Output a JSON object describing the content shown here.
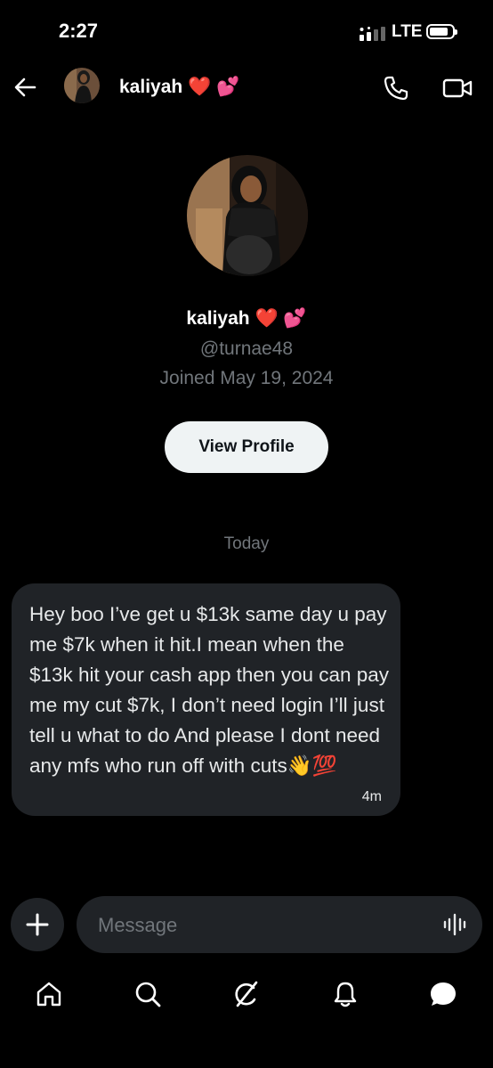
{
  "status_bar": {
    "time": "2:27",
    "network": "LTE"
  },
  "header": {
    "contact_name": "kaliyah",
    "name_emojis": "❤️ 💕"
  },
  "profile": {
    "name": "kaliyah",
    "name_emojis": "❤️ 💕",
    "handle": "@turnae48",
    "joined": "Joined May 19, 2024",
    "view_profile_label": "View Profile"
  },
  "conversation": {
    "date_divider": "Today",
    "messages": [
      {
        "text": "Hey boo I’ve get u $13k same day u pay me $7k when it hit.I mean when the $13k hit your cash app then you can pay me my cut $7k,  I don’t need login I’ll just tell u what to do And please I dont need any mfs who run off with cuts",
        "emojis": "👋💯",
        "time": "4m"
      }
    ]
  },
  "composer": {
    "placeholder": "Message"
  },
  "bottom_nav": [
    "home-icon",
    "search-icon",
    "grok-icon",
    "notifications-icon",
    "messages-icon"
  ],
  "colors": {
    "background": "#000000",
    "bubble": "#202327",
    "muted": "#71767b",
    "button": "#eff3f4"
  }
}
